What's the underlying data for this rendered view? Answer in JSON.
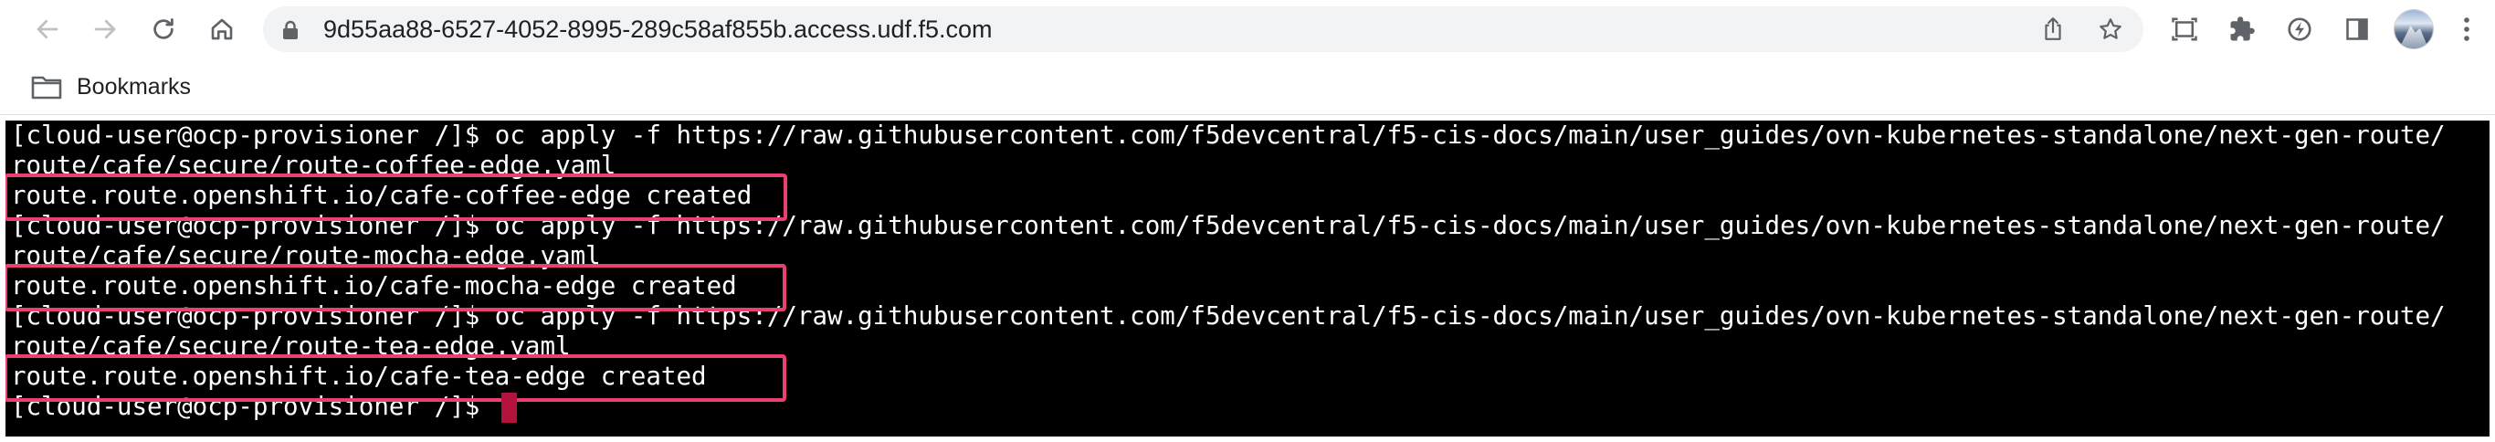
{
  "browser": {
    "url": "9d55aa88-6527-4052-8995-289c58af855b.access.udf.f5.com",
    "bookmarks_label": "Bookmarks",
    "nav_icons": [
      "back-arrow-icon",
      "forward-arrow-icon",
      "reload-icon",
      "home-icon"
    ],
    "omnibox_icons": [
      "lock-icon",
      "share-icon",
      "bookmark-star-icon"
    ],
    "toolbar_icons": [
      "tab-search-icon",
      "extensions-puzzle-icon",
      "performance-icon",
      "side-panel-icon",
      "profile-avatar",
      "kebab-menu-icon"
    ]
  },
  "terminal": {
    "lines": [
      "[cloud-user@ocp-provisioner /]$ oc apply -f https://raw.githubusercontent.com/f5devcentral/f5-cis-docs/main/user_guides/ovn-kubernetes-standalone/next-gen-route/",
      "route/cafe/secure/route-coffee-edge.yaml",
      "route.route.openshift.io/cafe-coffee-edge created",
      "[cloud-user@ocp-provisioner /]$ oc apply -f https://raw.githubusercontent.com/f5devcentral/f5-cis-docs/main/user_guides/ovn-kubernetes-standalone/next-gen-route/",
      "route/cafe/secure/route-mocha-edge.yaml",
      "route.route.openshift.io/cafe-mocha-edge created",
      "[cloud-user@ocp-provisioner /]$ oc apply -f https://raw.githubusercontent.com/f5devcentral/f5-cis-docs/main/user_guides/ovn-kubernetes-standalone/next-gen-route/",
      "route/cafe/secure/route-tea-edge.yaml",
      "route.route.openshift.io/cafe-tea-edge created",
      "[cloud-user@ocp-provisioner /]$ "
    ],
    "highlighted_lines": [
      2,
      5,
      8
    ],
    "highlight_color": "#ea3f6f",
    "cursor_color": "#b3123c",
    "background": "#000000",
    "foreground": "#ffffff"
  }
}
